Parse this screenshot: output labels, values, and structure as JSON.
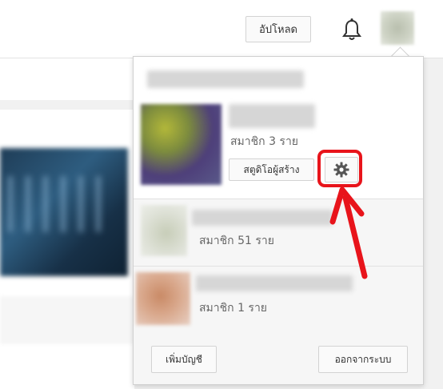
{
  "header": {
    "upload_label": "อัปโหลด",
    "notifications_icon": "bell-icon",
    "avatar_icon": "account-avatar"
  },
  "account_menu": {
    "current_channel": {
      "members": "สมาชิก 3 ราย",
      "creator_studio_label": "สตูดิโอผู้สร้าง",
      "settings_icon": "gear-icon"
    },
    "other_channels": [
      {
        "members": "สมาชิก 51 ราย"
      },
      {
        "members": "สมาชิก 1 ราย"
      }
    ],
    "footer": {
      "add_account_label": "เพิ่มบัญชี",
      "sign_out_label": "ออกจากระบบ"
    }
  },
  "annotation": {
    "highlight_color": "#e8141b",
    "arrow_icon": "arrow-icon"
  }
}
